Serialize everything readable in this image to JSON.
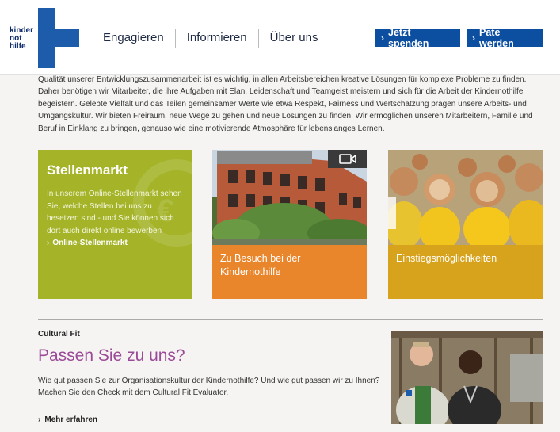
{
  "header": {
    "logo_lines": [
      "kinder",
      "not",
      "hilfe"
    ],
    "nav": [
      "Engagieren",
      "Informieren",
      "Über uns"
    ],
    "buttons": {
      "donate": "Jetzt spenden",
      "sponsor": "Pate werden"
    }
  },
  "intro": {
    "text": "Qualität unserer Entwicklungszusammenarbeit ist es wichtig, in allen Arbeitsbereichen kreative Lösungen für komplexe Probleme zu finden. Daher benötigen wir Mitarbeiter, die ihre Aufgaben mit Elan, Leidenschaft und Teamgeist meistern und sich für die Arbeit der Kindernothilfe begeistern. Gelebte Vielfalt und das Teilen gemeinsamer Werte wie etwa Respekt, Fairness und Wertschätzung prägen unsere Arbeits- und Umgangskultur. Wir bieten Freiraum, neue Wege zu gehen und neue Lösungen zu finden. Wir ermöglichen unseren Mitarbeitern, Familie und Beruf in Einklang zu bringen, genauso wie eine motivierende Atmosphäre für lebenslanges Lernen."
  },
  "tiles": [
    {
      "title": "Stellenmarkt",
      "text": "In unserem Online-Stellenmarkt sehen Sie, welche Stellen bei uns zu besetzen sind - und Sie können sich dort auch direkt online bewerben",
      "link": "Online-Stellenmarkt",
      "color": "#a4b328"
    },
    {
      "caption": "Zu Besuch bei der Kindernothilfe",
      "color": "#e9862c",
      "icon": "video-camera-icon"
    },
    {
      "caption": "Einstiegsmöglichkeiten",
      "color": "#d8a31c"
    }
  ],
  "cultural_fit": {
    "label": "Cultural Fit",
    "title": "Passen Sie zu uns?",
    "text": "Wie gut passen Sie zur Organisationskultur der Kindernothilfe? Und wie gut passen wir zu Ihnen? Machen Sie den Check mit dem Cultural Fit Evaluator.",
    "link": "Mehr erfahren"
  },
  "colors": {
    "brand_blue": "#0c4ea0",
    "logo_blue": "#1d5bab",
    "heading_purple": "#9b4a97"
  }
}
